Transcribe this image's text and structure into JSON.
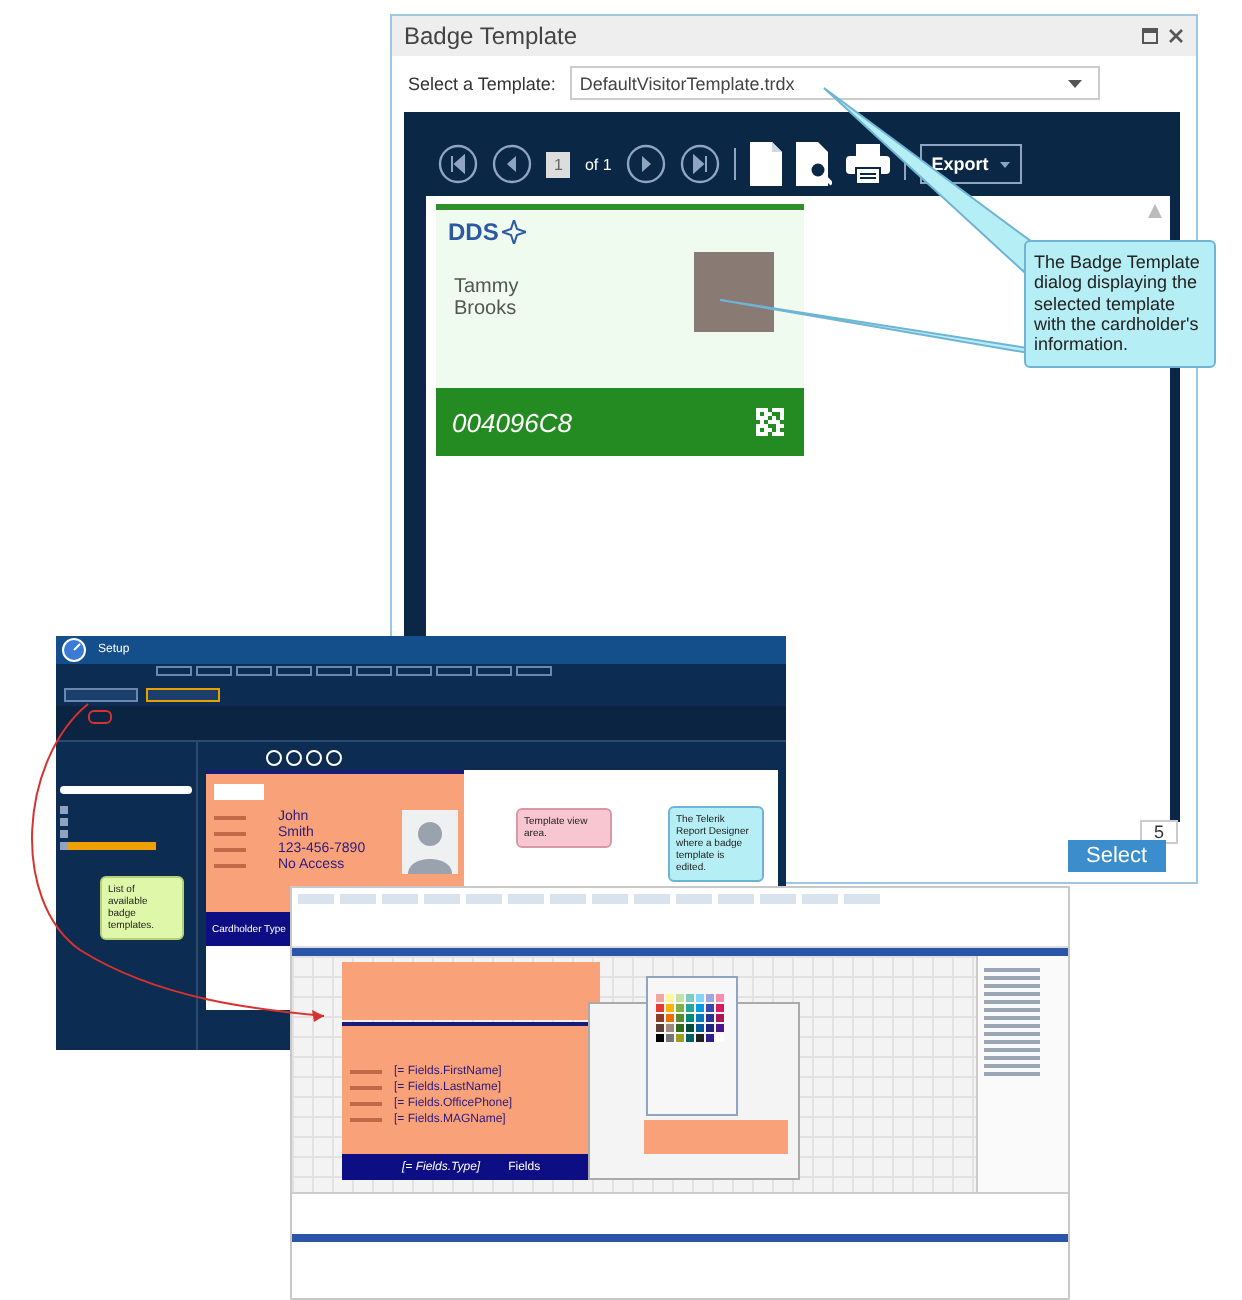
{
  "badge_dialog": {
    "title": "Badge Template",
    "template_label": "Select a Template:",
    "template_value": "DefaultVisitorTemplate.trdx",
    "page": "1",
    "page_count": "of 1",
    "export_button": "Export",
    "badge": {
      "logo": "DDS",
      "first_name": "Tammy",
      "last_name": "Brooks",
      "card_number": "004096C8"
    },
    "zoom_value": "5",
    "select_button": "Select"
  },
  "callouts": [
    {
      "kind": "dialog",
      "text": "The Badge Template dialog displaying the selected template with the cardholder's information.",
      "color": "#b5eef4"
    },
    {
      "kind": "list",
      "text": "List of available badge templates.",
      "color": "#dff7a8"
    },
    {
      "kind": "view",
      "text": "Template view area.",
      "color": "#f7c6d0"
    },
    {
      "kind": "designer",
      "text": "The Telerik Report Designer where a badge template is edited.",
      "color": "#b5eef4"
    }
  ],
  "setup_window": {
    "title": "Setup",
    "templates": [
      {
        "selected": false
      },
      {
        "selected": false
      },
      {
        "selected": false
      },
      {
        "selected": true
      }
    ],
    "preview": {
      "values": [
        "John",
        "Smith",
        "123-456-7890",
        "No Access"
      ],
      "cardholder_type_label": "Cardholder Type"
    }
  },
  "designer_window": {
    "fields": [
      "[= Fields.FirstName]",
      "[= Fields.LastName]",
      "[= Fields.OfficePhone]",
      "[= Fields.MAGName]"
    ],
    "type_field": "[= Fields.Type]",
    "cut_field": "Fields"
  }
}
